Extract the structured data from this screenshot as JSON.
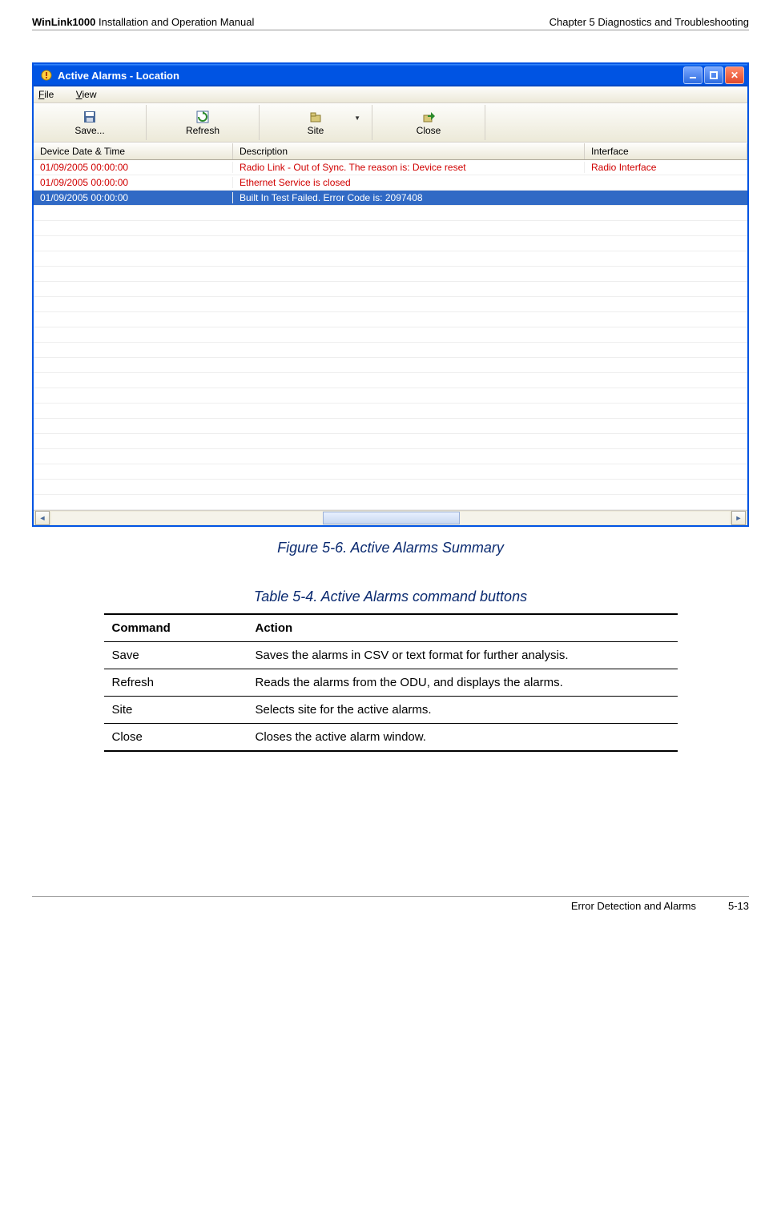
{
  "header": {
    "product": "WinLink1000",
    "doc": "Installation and Operation Manual",
    "chapter": "Chapter 5  Diagnostics and Troubleshooting"
  },
  "window": {
    "title": "Active Alarms - Location",
    "menus": {
      "file": "File",
      "view": "View"
    },
    "toolbar": {
      "save": "Save...",
      "refresh": "Refresh",
      "site": "Site",
      "close": "Close"
    },
    "columns": {
      "dt": "Device Date & Time",
      "desc": "Description",
      "iface": "Interface"
    },
    "rows": [
      {
        "dt": "01/09/2005 00:00:00",
        "desc": "Radio Link - Out of Sync. The reason is: Device reset",
        "iface": "Radio Interface",
        "style": "red"
      },
      {
        "dt": "01/09/2005 00:00:00",
        "desc": "Ethernet Service is closed",
        "iface": "",
        "style": "red"
      },
      {
        "dt": "01/09/2005 00:00:00",
        "desc": "Built In Test Failed. Error Code is: 2097408",
        "iface": "",
        "style": "sel"
      }
    ],
    "empty_rows": 20
  },
  "figure_caption": "Figure 5-6.  Active Alarms Summary",
  "table_caption": "Table 5-4.  Active Alarms command buttons",
  "table": {
    "head": {
      "cmd": "Command",
      "action": "Action"
    },
    "rows": [
      {
        "cmd": "Save",
        "action": "Saves the alarms in CSV or text format for further analysis."
      },
      {
        "cmd": "Refresh",
        "action": "Reads the alarms from the ODU, and displays the alarms."
      },
      {
        "cmd": "Site",
        "action": "Selects site for the active alarms."
      },
      {
        "cmd": "Close",
        "action": "Closes the active alarm window."
      }
    ]
  },
  "footer": {
    "section": "Error Detection and Alarms",
    "page": "5-13"
  }
}
